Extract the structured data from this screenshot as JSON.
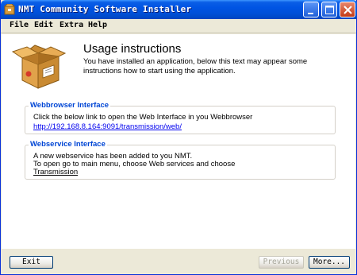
{
  "window": {
    "title": "NMT Community Software Installer",
    "title_color": "#ffffff",
    "titlebar_color": "#0054e3"
  },
  "titlebar_buttons": {
    "minimize": "minimize-icon",
    "maximize": "maximize-icon",
    "close": "close-icon"
  },
  "menu": {
    "items": [
      {
        "label": "File"
      },
      {
        "label": "Edit"
      },
      {
        "label": "Extra"
      },
      {
        "label": "Help"
      }
    ]
  },
  "main": {
    "icon": "package-box-icon",
    "heading": "Usage instructions",
    "intro": "You have installed an application, below this text may appear some instructions how to start using the application.",
    "groups": [
      {
        "title": "Webbrowser Interface",
        "lines": [
          "Click the below link to open the Web Interface in you Webbrowser",
          "http://192.168.8.164:9091/transmission/web/"
        ]
      },
      {
        "title": "Webservice Interface",
        "lines": [
          "A new webservice has been added to you NMT.",
          "To open go to main menu, choose Web services and choose",
          "Transmission"
        ]
      }
    ],
    "accent_color": "#0046d5",
    "link_color": "#0000ee"
  },
  "footer": {
    "exit_label": "Exit",
    "previous_label": "Previous",
    "more_label": "More..."
  }
}
